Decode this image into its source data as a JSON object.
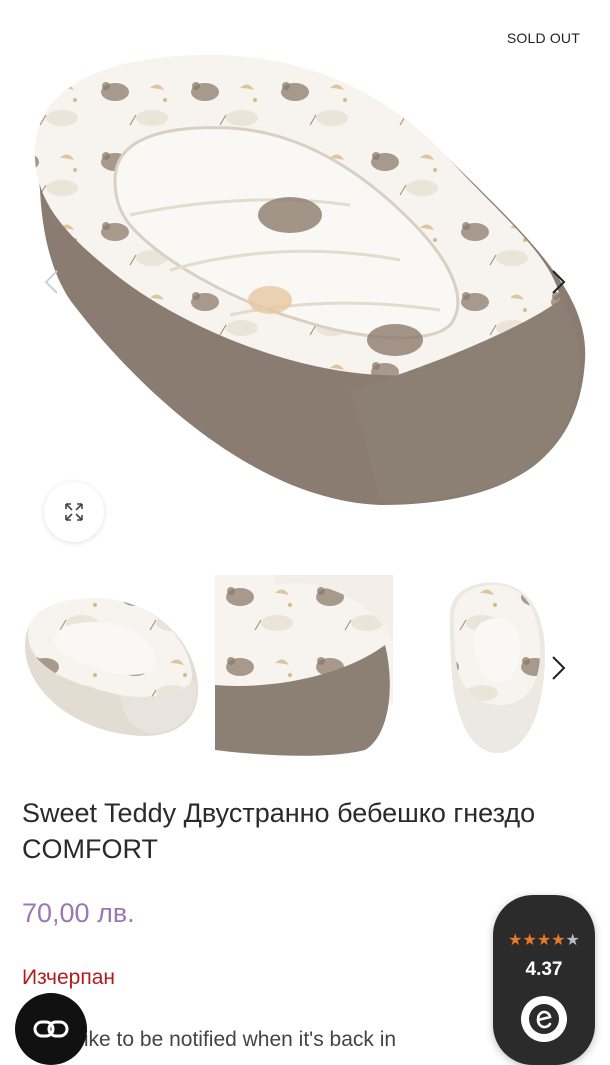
{
  "gallery": {
    "badge": "SOLD OUT",
    "main_image_alt": "Sweet Teddy baby nest",
    "zoom_icon": "expand-icon",
    "prev_icon": "chevron-left-icon",
    "next_icon": "chevron-right-icon",
    "thumbnails_next_icon": "chevron-right-icon"
  },
  "product": {
    "title": "Sweet Teddy Двустранно бебешко гнездо COMFORT",
    "price": "70,00 лв.",
    "stock_status": "Изчерпан",
    "notify_text": "d you like to be notified when it's back in"
  },
  "rating_widget": {
    "stars": "★★★★",
    "last_star": "★",
    "value": "4.37",
    "logo_letter": "e"
  },
  "colors": {
    "price": "#9a78b4",
    "stock": "#b21c1c",
    "star": "#e87a2a",
    "widget_bg": "#2b2b2b"
  }
}
